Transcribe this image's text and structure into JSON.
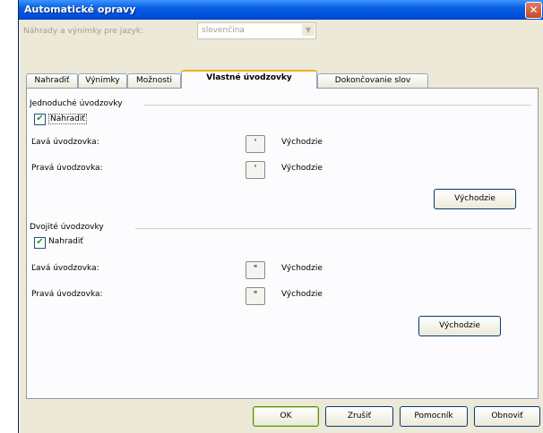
{
  "window": {
    "title": "Automatické opravy",
    "close_glyph": "✕"
  },
  "language": {
    "label": "Náhrady a výnimky pre jazyk:",
    "value": "slovenčina",
    "arrow": "▼"
  },
  "tabs": [
    {
      "label": "Nahradiť"
    },
    {
      "label": "Výnimky"
    },
    {
      "label": "Možnosti"
    },
    {
      "label": "Vlastné úvodzovky",
      "active": true
    },
    {
      "label": "Dokončovanie slov"
    }
  ],
  "single": {
    "group_label": "Jednoduché úvodzovky",
    "replace_label": "Nahradiť",
    "replace_checked": true,
    "left_label": "Ľavá úvodzovka:",
    "left_char": "'",
    "left_default": "Východzie",
    "right_label": "Pravá úvodzovka:",
    "right_char": "'",
    "right_default": "Východzie",
    "default_button": "Východzie"
  },
  "double": {
    "group_label": "Dvojité úvodzovky",
    "replace_label": "Nahradiť",
    "replace_checked": true,
    "left_label": "Ľavá úvodzovka:",
    "left_char": "\"",
    "left_default": "Východzie",
    "right_label": "Pravá úvodzovka:",
    "right_char": "\"",
    "right_default": "Východzie",
    "default_button": "Východzie"
  },
  "checkmark": "✔",
  "buttons": {
    "ok": "OK",
    "cancel": "Zrušiť",
    "help": "Pomocník",
    "restore": "Obnoviť"
  }
}
